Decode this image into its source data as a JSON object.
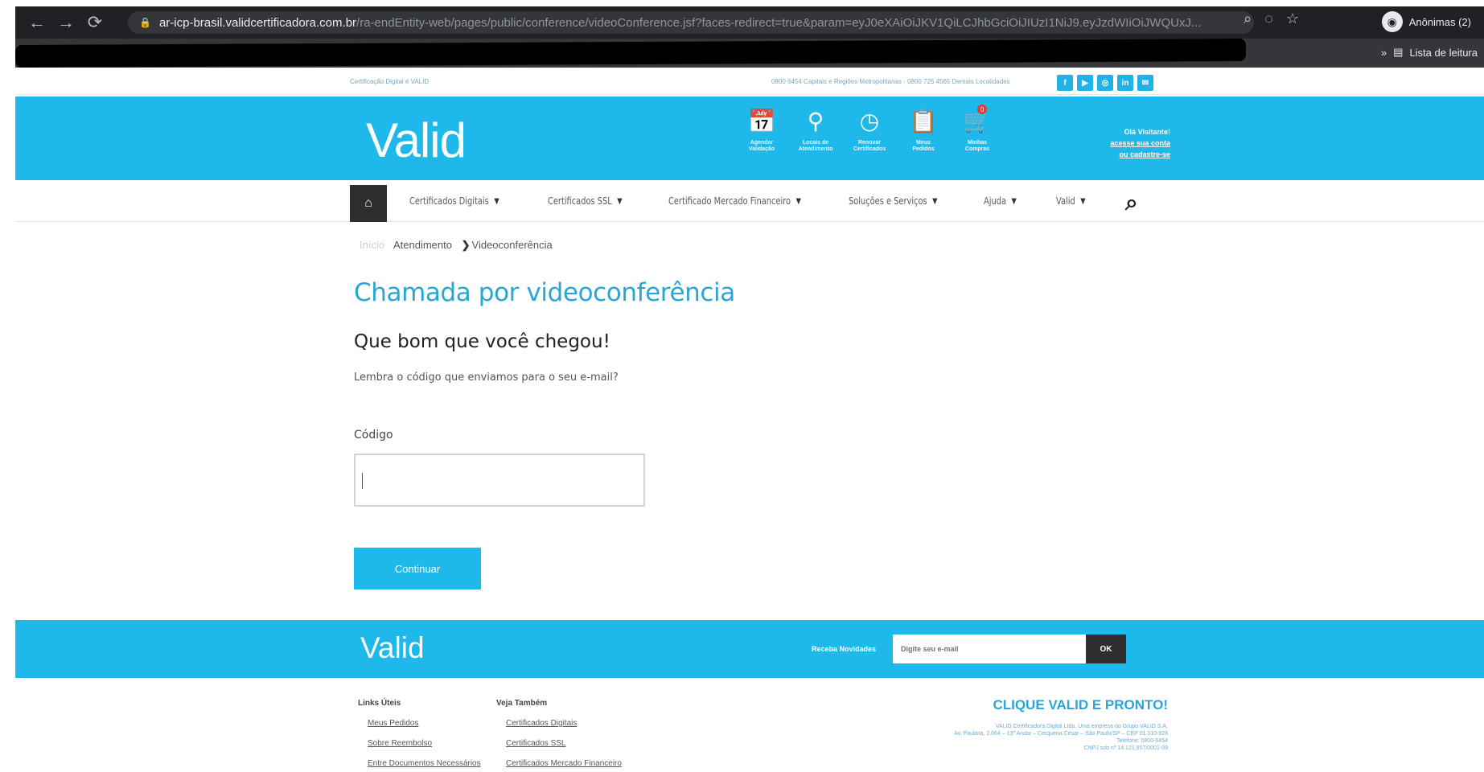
{
  "browser": {
    "url_host": "ar-icp-brasil.validcertificadora.com.br",
    "url_path": "/ra-endEntity-web/pages/public/conference/videoConference.jsf?faces-redirect=true&param=eyJ0eXAiOiJKV1QiLCJhbGciOiJIUzI1NiJ9.eyJzdWIiOiJWQUxJ...",
    "profile_label": "Anônimas (2)",
    "reading_list": "Lista de leitura"
  },
  "utility": {
    "left_text": "Certificação Digital é VALID",
    "right_text": "0800 6454 Capitais e Regiões Metropolitanas · 0800 725 4565 Demais Localidades",
    "social": [
      "f",
      "▶",
      "◎",
      "in",
      "✉"
    ]
  },
  "header": {
    "logo": "Valid",
    "icons": [
      {
        "name": "calendar-icon",
        "glyph": "📅",
        "label": "Agendar Validação"
      },
      {
        "name": "location-pin-icon",
        "glyph": "⚲",
        "label": "Locais de Atendimento"
      },
      {
        "name": "clock-icon",
        "glyph": "◷",
        "label": "Renovar Certificados"
      },
      {
        "name": "clipboard-icon",
        "glyph": "📋",
        "label": "Meus Pedidos"
      },
      {
        "name": "cart-icon",
        "glyph": "🛒",
        "label": "Minhas Compras"
      }
    ],
    "cart_count": "0",
    "user": {
      "greeting": "Olá Visitante!",
      "login": "acesse sua conta",
      "register": "ou cadastre-se"
    }
  },
  "nav": {
    "items": [
      "Certificados Digitais",
      "Certificados SSL",
      "Certificado Mercado Financeiro",
      "Soluções e Serviços",
      "Ajuda",
      "Valid"
    ]
  },
  "breadcrumb": {
    "home": "Início",
    "level1": "Atendimento",
    "level2": "Videoconferência"
  },
  "main": {
    "title": "Chamada por videoconferência",
    "welcome": "Que bom que você chegou!",
    "hint": "Lembra o código que enviamos para o seu e-mail?",
    "code_label": "Código",
    "code_value": "",
    "continue": "Continuar"
  },
  "footer": {
    "logo": "Valid",
    "news_label": "Receba Novidades",
    "news_placeholder": "Digite seu e-mail",
    "ok": "OK",
    "col1_title": "Links Úteis",
    "col1_links": [
      "Meus Pedidos",
      "Sobre Reembolso",
      "Entre Documentos Necessários"
    ],
    "col2_title": "Veja Também",
    "col2_links": [
      "Certificados Digitais",
      "Certificados SSL",
      "Certificados Mercado Financeiro"
    ],
    "slogan": "CLIQUE VALID E PRONTO!",
    "address_lines": [
      "VALID Certificadora Digital Ltda. Uma empresa do Grupo VALID S.A.",
      "Av. Paulista, 2.064 – 13º Andar – Cerqueira César – São Paulo/SP – CEP 01.310-928",
      "Telefone: 0800-6454",
      "CNPJ sob nº 14.121.957/0001-09"
    ]
  },
  "colors": {
    "brand": "#1fb8ea",
    "title": "#2aa6d6",
    "dark": "#2e2e2e"
  }
}
